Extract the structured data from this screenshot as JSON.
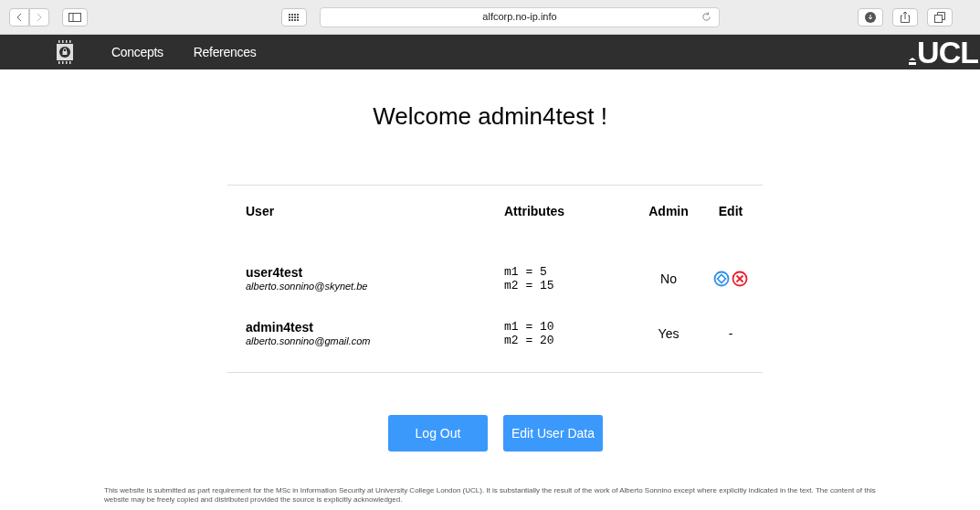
{
  "browser": {
    "url": "alfcorp.no-ip.info"
  },
  "nav": {
    "links": [
      "Concepts",
      "References"
    ],
    "logo_text": "UCL"
  },
  "heading": "Welcome admin4test !",
  "table": {
    "columns": [
      "User",
      "Attributes",
      "Admin",
      "Edit"
    ],
    "rows": [
      {
        "name": "user4test",
        "email": "alberto.sonnino@skynet.be",
        "attributes": [
          "m1 = 5",
          "m2 = 15"
        ],
        "admin": "No",
        "edit": {
          "kind": "icons"
        }
      },
      {
        "name": "admin4test",
        "email": "alberto.sonnino@gmail.com",
        "attributes": [
          "m1 = 10",
          "m2 = 20"
        ],
        "admin": "Yes",
        "edit": {
          "kind": "text",
          "text": "-"
        }
      }
    ]
  },
  "buttons": [
    "Log Out",
    "Edit User Data"
  ],
  "footer": "This website is submitted as part requirement for the MSc in Information Security at University College London (UCL). It is substantially the result of the work of Alberto Sonnino except where explicitly indicated in the text. The content of this website may be freely copied and distributed provided the source is explicitly acknowledged."
}
